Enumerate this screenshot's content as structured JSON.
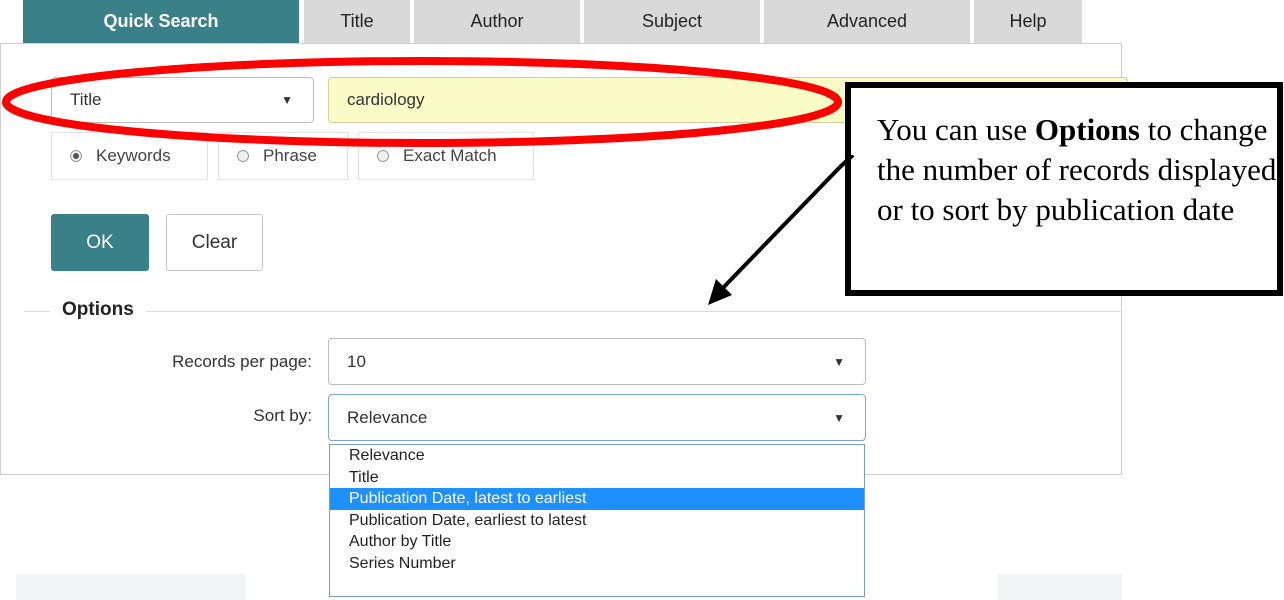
{
  "tabs": [
    "Quick Search",
    "Title",
    "Author",
    "Subject",
    "Advanced",
    "Help"
  ],
  "search": {
    "field_select": "Title",
    "query": "cardiology"
  },
  "match_options": [
    {
      "label": "Keywords",
      "checked": true
    },
    {
      "label": "Phrase",
      "checked": false
    },
    {
      "label": "Exact Match",
      "checked": false
    }
  ],
  "buttons": {
    "ok": "OK",
    "clear": "Clear"
  },
  "options": {
    "legend": "Options",
    "records_label": "Records per page:",
    "records_value": "10",
    "sort_label": "Sort by:",
    "sort_value": "Relevance",
    "sort_options": [
      "Relevance",
      "Title",
      "Publication Date, latest to earliest",
      "Publication Date, earliest to latest",
      "Author by Title",
      "Series Number"
    ],
    "highlighted_option": "Publication Date, latest to earliest"
  },
  "callout": {
    "before": "You can use ",
    "bold": "Options",
    "after": " to change the number of records displayed or to sort by publication date"
  },
  "colors": {
    "accent": "#3a8089",
    "highlight_ellipse": "#ff0000",
    "search_bg": "#fbfbc8",
    "selected_option": "#1e90ff"
  }
}
